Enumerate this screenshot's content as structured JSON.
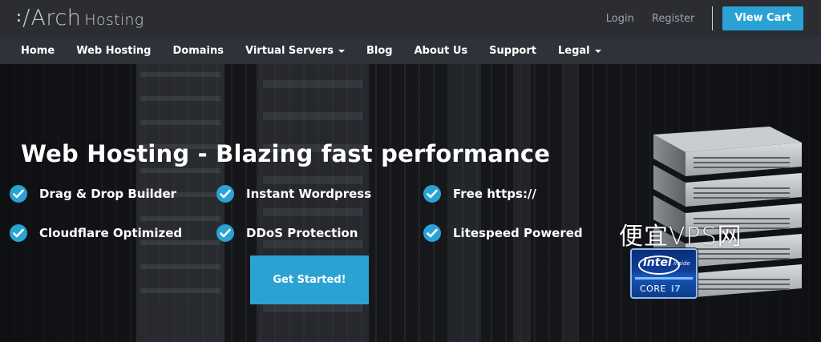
{
  "header": {
    "logo": {
      "brand": "Arch",
      "sub": "Hosting"
    },
    "links": {
      "login": "Login",
      "register": "Register"
    },
    "cart_label": "View Cart"
  },
  "nav": {
    "items": [
      {
        "label": "Home",
        "dropdown": false
      },
      {
        "label": "Web Hosting",
        "dropdown": false
      },
      {
        "label": "Domains",
        "dropdown": false
      },
      {
        "label": "Virtual Servers",
        "dropdown": true
      },
      {
        "label": "Blog",
        "dropdown": false
      },
      {
        "label": "About Us",
        "dropdown": false
      },
      {
        "label": "Support",
        "dropdown": false
      },
      {
        "label": "Legal",
        "dropdown": true
      }
    ]
  },
  "hero": {
    "title": "Web Hosting - Blazing fast performance",
    "features": [
      "Drag & Drop Builder",
      "Instant Wordpress",
      "Free https://",
      "Cloudflare Optimized",
      "DDoS Protection",
      "Litespeed Powered"
    ],
    "cta_label": "Get Started!",
    "badge": {
      "brand": "intel",
      "inside": "inside",
      "core": "CORE",
      "model": "i7"
    }
  },
  "watermark": "便宜VPS网",
  "colors": {
    "accent": "#2aa3d4",
    "topbar": "#2b2d33",
    "nav": "#2f3238"
  }
}
